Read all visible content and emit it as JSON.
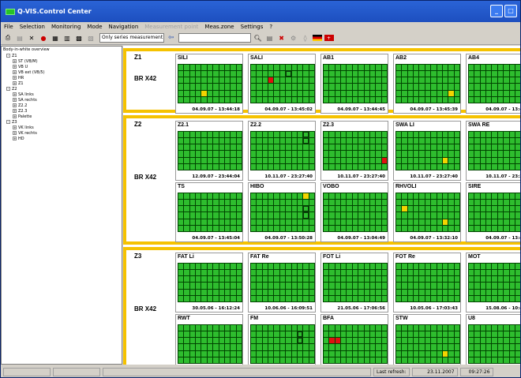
{
  "window": {
    "title": "Q-VIS.Control Center"
  },
  "menu": [
    {
      "label": "File",
      "disabled": false
    },
    {
      "label": "Selection",
      "disabled": false
    },
    {
      "label": "Monitoring",
      "disabled": false
    },
    {
      "label": "Mode",
      "disabled": false
    },
    {
      "label": "Navigation",
      "disabled": false
    },
    {
      "label": "Measurement point",
      "disabled": true
    },
    {
      "label": "Meas.zone",
      "disabled": false
    },
    {
      "label": "Settings",
      "disabled": false
    },
    {
      "label": "?",
      "disabled": false
    }
  ],
  "toolbar": {
    "filter_select": "Only series measurement ▾"
  },
  "tree": {
    "root": "Body-in-white overview",
    "nodes": [
      {
        "label": "Z1",
        "level": 0,
        "pm": "-"
      },
      {
        "label": "ST (VB/M)",
        "level": 1,
        "pm": "+"
      },
      {
        "label": "VB U",
        "level": 1,
        "pm": "+"
      },
      {
        "label": "VB ext (VB/5)",
        "level": 1,
        "pm": "+"
      },
      {
        "label": "HR",
        "level": 1,
        "pm": "+"
      },
      {
        "label": "Z1",
        "level": 1,
        "pm": "+"
      },
      {
        "label": "Z2",
        "level": 0,
        "pm": "-"
      },
      {
        "label": "SA links",
        "level": 1,
        "pm": "+"
      },
      {
        "label": "SA rechts",
        "level": 1,
        "pm": "+"
      },
      {
        "label": "Z2.2",
        "level": 1,
        "pm": "+"
      },
      {
        "label": "Z2.3",
        "level": 1,
        "pm": "+"
      },
      {
        "label": "Palette",
        "level": 1,
        "pm": "+"
      },
      {
        "label": "Z3",
        "level": 0,
        "pm": "-"
      },
      {
        "label": "VK links",
        "level": 1,
        "pm": "+"
      },
      {
        "label": "VK rechts",
        "level": 1,
        "pm": "+"
      },
      {
        "label": "HD",
        "level": 1,
        "pm": "+"
      }
    ]
  },
  "zones": [
    {
      "label": "Z1",
      "body": "BR X42",
      "rows": [
        [
          {
            "title": "SILI",
            "date": "04.09.07 - 13:44:18",
            "marks": {
              "y": [
                48
              ],
              "r": [],
              "o": []
            }
          },
          {
            "title": "SALI",
            "date": "04.09.07 - 13:45:02",
            "marks": {
              "y": [],
              "r": [
                25
              ],
              "o": [
                17
              ]
            }
          },
          {
            "title": "AB1",
            "date": "04.09.07 - 13:44:45",
            "marks": {
              "y": [],
              "r": [],
              "o": []
            }
          },
          {
            "title": "AB2",
            "date": "04.09.07 - 13:45:39",
            "marks": {
              "y": [
                53
              ],
              "r": [],
              "o": []
            }
          },
          {
            "title": "AB4",
            "date": "04.09.07 - 13:49:2",
            "marks": {
              "y": [],
              "r": [],
              "o": []
            }
          }
        ]
      ]
    },
    {
      "label": "Z2",
      "body": "BR X42",
      "rows": [
        [
          {
            "title": "Z2.1",
            "date": "12.09.07 - 23:44:04",
            "marks": {
              "y": [],
              "r": [],
              "o": []
            }
          },
          {
            "title": "Z2.2",
            "date": "10.11.07 - 23:27:40",
            "marks": {
              "y": [],
              "r": [],
              "o": [
                9,
                20
              ]
            }
          },
          {
            "title": "Z2.3",
            "date": "10.11.07 - 23:27:40",
            "marks": {
              "y": [],
              "r": [
                54
              ],
              "o": []
            }
          },
          {
            "title": "SWA LI",
            "date": "10.11.07 - 23:27:40",
            "marks": {
              "y": [
                52
              ],
              "r": [],
              "o": []
            }
          },
          {
            "title": "SWA RE",
            "date": "10.11.07 - 23:27:4",
            "marks": {
              "y": [],
              "r": [],
              "o": []
            }
          }
        ],
        [
          {
            "title": "TS",
            "date": "04.09.07 - 13:45:04",
            "marks": {
              "y": [],
              "r": [],
              "o": []
            }
          },
          {
            "title": "HIBO",
            "date": "04.09.07 - 13:50:28",
            "marks": {
              "y": [
                9
              ],
              "r": [],
              "o": [
                31,
                42
              ]
            }
          },
          {
            "title": "VOBO",
            "date": "04.09.07 - 13:04:49",
            "marks": {
              "y": [],
              "r": [],
              "o": []
            }
          },
          {
            "title": "RHVOLI",
            "date": "04.09.07 - 13:32:10",
            "marks": {
              "y": [
                23,
                52
              ],
              "r": [],
              "o": []
            }
          },
          {
            "title": "SIRE",
            "date": "04.09.07 - 13:45:2",
            "marks": {
              "y": [],
              "r": [],
              "o": []
            }
          }
        ]
      ]
    },
    {
      "label": "Z3",
      "body": "BR X42",
      "rows": [
        [
          {
            "title": "FAT Li",
            "date": "30.05.06 - 16:12:24",
            "marks": {
              "y": [],
              "r": [],
              "o": []
            }
          },
          {
            "title": "FAT Re",
            "date": "10.06.06 - 16:09:51",
            "marks": {
              "y": [],
              "r": [],
              "o": []
            }
          },
          {
            "title": "FOT Li",
            "date": "21.05.06 - 17:06:56",
            "marks": {
              "y": [],
              "r": [],
              "o": []
            }
          },
          {
            "title": "FOT Re",
            "date": "10.05.06 - 17:03:43",
            "marks": {
              "y": [],
              "r": [],
              "o": []
            }
          },
          {
            "title": "MOT",
            "date": "15.08.06 - 10:42:2",
            "marks": {
              "y": [],
              "r": [],
              "o": []
            }
          }
        ],
        [
          {
            "title": "RWT",
            "date": "10.11.07 - 23:27:40",
            "marks": {
              "y": [],
              "r": [],
              "o": []
            }
          },
          {
            "title": "FM",
            "date": "10.11.07 - 23:27:40",
            "marks": {
              "y": [],
              "r": [],
              "o": [
                19,
                30
              ]
            }
          },
          {
            "title": "BFA",
            "date": "10.11.07 - 23:27:40",
            "marks": {
              "y": [],
              "r": [
                23,
                24
              ],
              "o": []
            }
          },
          {
            "title": "STW",
            "date": "04.09.07 - 13:44:40",
            "marks": {
              "y": [
                52
              ],
              "r": [],
              "o": []
            }
          },
          {
            "title": "U8",
            "date": "04.09.07 - 13:44:1",
            "marks": {
              "y": [],
              "r": [],
              "o": []
            }
          }
        ]
      ]
    }
  ],
  "status": {
    "refresh_label": "Last refresh:",
    "date": "23.11.2007",
    "time": "09:27:26"
  },
  "colors": {
    "zone_border": "#f5c200",
    "ok": "#2ebd2e",
    "warn": "#f3d400",
    "alarm": "#e01010"
  }
}
